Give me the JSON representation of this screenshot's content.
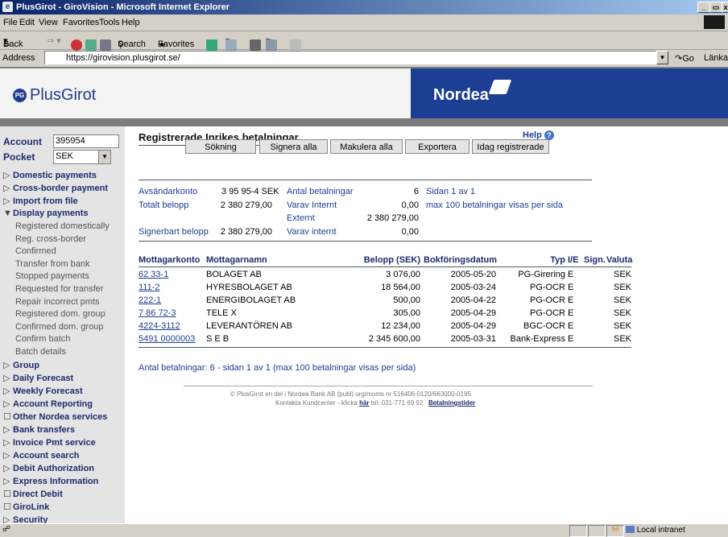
{
  "window": {
    "title": "PlusGirot - GiroVision - Microsoft Internet Explorer",
    "buttons": [
      "_",
      "ʙ",
      "×"
    ]
  },
  "menu": [
    "File",
    "Edit",
    "View",
    "Favorites",
    "Tools",
    "Help"
  ],
  "toolbar": {
    "back": "Back",
    "search": "Search",
    "favorites": "Favorites"
  },
  "address": {
    "label": "Address",
    "url": "https://girovision.plusgirot.se/",
    "go": "Go",
    "links": "Länkar"
  },
  "brand": {
    "plusgirot": "PlusGirot",
    "logo_mark": "PG",
    "nordea": "Nordea"
  },
  "sidebar": {
    "account_label": "Account",
    "account_value": "395954",
    "pocket_label": "Pocket",
    "pocket_value": "SEK",
    "nav": [
      {
        "label": "Domestic payments",
        "marker": "▷"
      },
      {
        "label": "Cross-border payment",
        "marker": "▷"
      },
      {
        "label": "Import from file",
        "marker": "▷"
      },
      {
        "label": "Display payments",
        "marker": "▼"
      }
    ],
    "sub": [
      "Registered domestically",
      "Reg. cross-border",
      "Confirmed",
      "Transfer from bank",
      "Stopped payments",
      "Requested for transfer",
      "Repair incorrect pmts",
      "Registered dom. group",
      "Confirmed dom. group",
      "Confirm batch",
      "Batch details"
    ],
    "nav2": [
      {
        "label": "Group",
        "marker": "▷"
      },
      {
        "label": "Daily Forecast",
        "marker": "▷"
      },
      {
        "label": "Weekly Forecast",
        "marker": "▷"
      },
      {
        "label": "Account Reporting",
        "marker": "▷"
      },
      {
        "label": "Other Nordea services",
        "marker": "☐"
      },
      {
        "label": "Bank transfers",
        "marker": "▷"
      },
      {
        "label": "Invoice Pmt service",
        "marker": "▷"
      },
      {
        "label": "Account search",
        "marker": "▷"
      },
      {
        "label": "Debit Authorization",
        "marker": "▷"
      },
      {
        "label": "Express Information",
        "marker": "▷"
      },
      {
        "label": "Direct Debit",
        "marker": "☐"
      },
      {
        "label": "GiroLink",
        "marker": "☐"
      },
      {
        "label": "Security",
        "marker": "▷"
      }
    ]
  },
  "main": {
    "heading": "Registrerade Inrikes betalningar",
    "help": "Help",
    "buttons": [
      "Sökning",
      "Signera alla",
      "Makulera alla",
      "Exportera",
      "Idag registrerade"
    ],
    "summary": {
      "avsandarkonto_label": "Avsändarkonto",
      "avsandarkonto_value": "3 95 95-4 SEK",
      "antal_label": "Antal betalningar",
      "antal_value": "6",
      "sidan": "Sidan 1 av 1",
      "totalt_label": "Totalt belopp",
      "totalt_value": "2 380 279,00",
      "varav_internt_label": "Varav Internt",
      "varav_internt_value": "0,00",
      "max_note": "max 100 betalningar visas per sida",
      "externt_label": "Externt",
      "externt_value": "2 380 279,00",
      "signerbart_label": "Signerbart belopp",
      "signerbart_value": "2 380 279,00",
      "varav_internt2_label": "Varav internt",
      "varav_internt2_value": "0,00"
    },
    "table": {
      "headers": [
        "Mottagarkonto",
        "Mottagarnamn",
        "Belopp (SEK)",
        "Bokföringsdatum",
        "Typ",
        "I/E",
        "Sign.",
        "Valuta"
      ],
      "rows": [
        {
          "konto": "62 33-1",
          "namn": "BOLAGET AB",
          "belopp": "3 076,00",
          "datum": "2005-05-20",
          "typ": "PG-Girering",
          "ie": "E",
          "valuta": "SEK"
        },
        {
          "konto": "111-2",
          "namn": "HYRESBOLAGET AB",
          "belopp": "18 564,00",
          "datum": "2005-03-24",
          "typ": "PG-OCR",
          "ie": "E",
          "valuta": "SEK"
        },
        {
          "konto": "222-1",
          "namn": "ENERGIBOLAGET AB",
          "belopp": "500,00",
          "datum": "2005-04-22",
          "typ": "PG-OCR",
          "ie": "E",
          "valuta": "SEK"
        },
        {
          "konto": "7 86 72-3",
          "namn": "TELE X",
          "belopp": "305,00",
          "datum": "2005-04-29",
          "typ": "PG-OCR",
          "ie": "E",
          "valuta": "SEK"
        },
        {
          "konto": "4224-3112",
          "namn": "LEVERANTÖREN AB",
          "belopp": "12 234,00",
          "datum": "2005-04-29",
          "typ": "BGC-OCR",
          "ie": "E",
          "valuta": "SEK"
        },
        {
          "konto": "5491 0000003",
          "namn": "S E B",
          "belopp": "2 345 600,00",
          "datum": "2005-03-31",
          "typ": "Bank-Express",
          "ie": "E",
          "valuta": "SEK"
        }
      ]
    },
    "footer_count": "Antal betalningar: 6 - sidan 1 av 1    (max 100 betalningar visas per sida)",
    "legal_line1": "© PlusGirot en del i Nordea Bank AB (publ)  org/moms nr 516406-0120/663000-0195",
    "legal_line2_pre": "Kontakta Kundcenter - klicka",
    "legal_line2_link": "här",
    "legal_line2_tel": "tel: 031-771 69 92",
    "legal_line2_link2": "Betalningstider"
  },
  "status": {
    "zone": "Local intranet"
  }
}
